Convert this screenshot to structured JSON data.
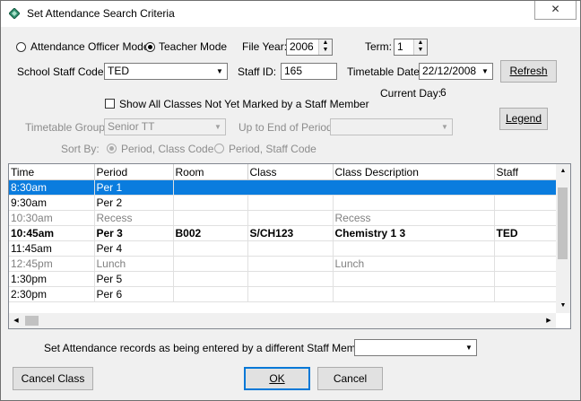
{
  "window": {
    "title": "Set Attendance Search Criteria",
    "close_label": "✕"
  },
  "mode": {
    "officer_label": "Attendance Officer Mode",
    "teacher_label": "Teacher Mode",
    "selected": "teacher"
  },
  "file_year": {
    "label": "File Year:",
    "value": "2006"
  },
  "term": {
    "label": "Term:",
    "value": "1"
  },
  "staff_code": {
    "label": "School Staff Code:",
    "value": "TED"
  },
  "staff_id": {
    "label": "Staff ID:",
    "value": "165"
  },
  "timetable_date": {
    "label": "Timetable Date:",
    "value": "22/12/2008"
  },
  "refresh_label": "Refresh",
  "current_day": {
    "label": "Current Day:",
    "value": "6"
  },
  "show_all": {
    "label": "Show All Classes Not Yet Marked by a Staff Member",
    "checked": false
  },
  "legend_label": "Legend",
  "timetable_group": {
    "label": "Timetable Group:",
    "value": "Senior TT"
  },
  "up_to_period": {
    "label": "Up to End of Period:",
    "value": ""
  },
  "sort_by": {
    "label": "Sort By:",
    "option1": "Period, Class Code",
    "option2": "Period, Staff Code",
    "selected": "option1"
  },
  "table": {
    "columns": [
      "Time",
      "Period",
      "Room",
      "Class",
      "Class Description",
      "Staff"
    ],
    "rows": [
      {
        "style": "sel",
        "cells": [
          "8:30am",
          "Per 1",
          "",
          "",
          "",
          ""
        ]
      },
      {
        "style": "",
        "cells": [
          "9:30am",
          "Per 2",
          "",
          "",
          "",
          ""
        ]
      },
      {
        "style": "grey",
        "cells": [
          "10:30am",
          "Recess",
          "",
          "",
          "Recess",
          ""
        ]
      },
      {
        "style": "bold",
        "cells": [
          "10:45am",
          "Per 3",
          "B002",
          "S/CH123",
          "Chemistry 1 3",
          "TED"
        ]
      },
      {
        "style": "",
        "cells": [
          "11:45am",
          "Per 4",
          "",
          "",
          "",
          ""
        ]
      },
      {
        "style": "grey",
        "cells": [
          "12:45pm",
          "Lunch",
          "",
          "",
          "Lunch",
          ""
        ]
      },
      {
        "style": "",
        "cells": [
          "1:30pm",
          "Per 5",
          "",
          "",
          "",
          ""
        ]
      },
      {
        "style": "",
        "cells": [
          "2:30pm",
          "Per 6",
          "",
          "",
          "",
          ""
        ]
      }
    ]
  },
  "different_staff": {
    "label": "Set Attendance records as being entered by a different Staff Member:",
    "value": ""
  },
  "cancel_class_label": "Cancel Class",
  "ok_label": "OK",
  "cancel_label": "Cancel",
  "colors": {
    "selection": "#0a7cde",
    "default_button_border": "#0078d7"
  }
}
